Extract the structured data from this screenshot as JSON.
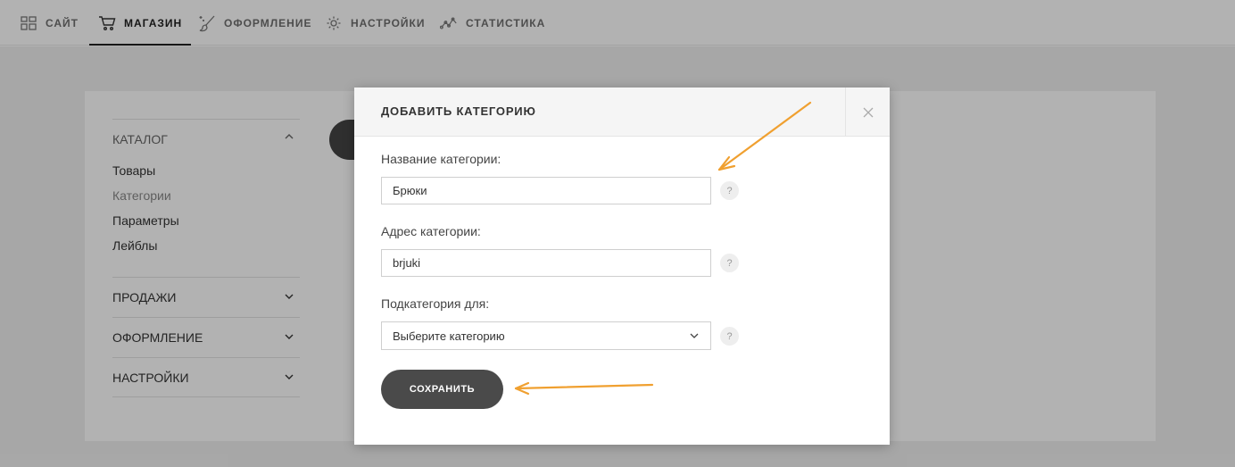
{
  "nav": {
    "items": [
      {
        "label": "САЙТ",
        "icon": "grid-icon"
      },
      {
        "label": "МАГАЗИН",
        "icon": "cart-icon"
      },
      {
        "label": "ОФОРМЛЕНИЕ",
        "icon": "brush-icon"
      },
      {
        "label": "НАСТРОЙКИ",
        "icon": "gear-icon"
      },
      {
        "label": "СТАТИСТИКА",
        "icon": "chart-line-icon"
      }
    ],
    "active": "МАГАЗИН"
  },
  "sidebar": {
    "catalog": {
      "title": "КАТАЛОГ",
      "links": [
        "Товары",
        "Категории",
        "Параметры",
        "Лейблы"
      ],
      "active": "Категории"
    },
    "sections": [
      "ПРОДАЖИ",
      "ОФОРМЛЕНИЕ",
      "НАСТРОЙКИ"
    ]
  },
  "modal": {
    "title": "ДОБАВИТЬ КАТЕГОРИЮ",
    "close_icon": "close-icon",
    "fields": {
      "name": {
        "label": "Название категории:",
        "value": "Брюки"
      },
      "slug": {
        "label": "Адрес категории:",
        "value": "brjuki"
      },
      "parent": {
        "label": "Подкатегория для:",
        "value": "Выберите категорию"
      }
    },
    "help_text": "?",
    "save_label": "СОХРАНИТЬ"
  },
  "colors": {
    "accent_arrow": "#f0a030",
    "button": "#4a4a4a",
    "overlay": "rgba(0,0,0,0.30)"
  }
}
